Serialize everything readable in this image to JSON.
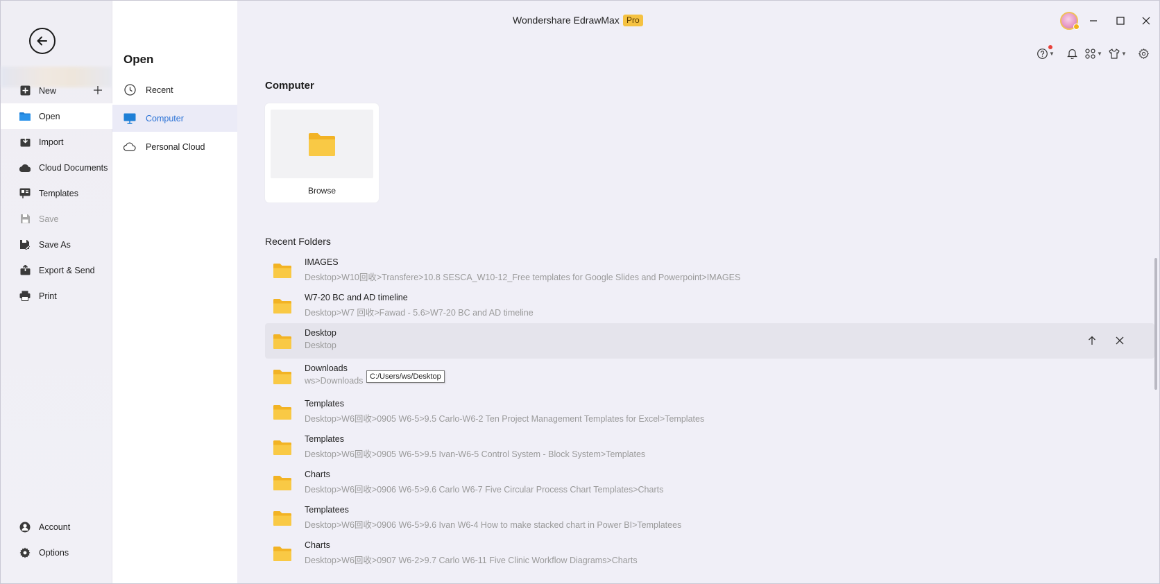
{
  "window": {
    "title": "Wondershare EdrawMax",
    "badge": "Pro"
  },
  "sidebar": {
    "items": [
      {
        "label": "New",
        "icon": "plus-square-icon"
      },
      {
        "label": "Open",
        "icon": "folder-icon"
      },
      {
        "label": "Import",
        "icon": "import-icon"
      },
      {
        "label": "Cloud Documents",
        "icon": "cloud-icon"
      },
      {
        "label": "Templates",
        "icon": "templates-icon"
      },
      {
        "label": "Save",
        "icon": "save-icon"
      },
      {
        "label": "Save As",
        "icon": "save-as-icon"
      },
      {
        "label": "Export & Send",
        "icon": "export-icon"
      },
      {
        "label": "Print",
        "icon": "print-icon"
      }
    ],
    "bottom": [
      {
        "label": "Account",
        "icon": "account-icon"
      },
      {
        "label": "Options",
        "icon": "gear-icon"
      }
    ]
  },
  "open_panel": {
    "title": "Open",
    "items": [
      {
        "label": "Recent",
        "icon": "clock-icon"
      },
      {
        "label": "Computer",
        "icon": "monitor-icon"
      },
      {
        "label": "Personal Cloud",
        "icon": "cloud-outline-icon"
      }
    ]
  },
  "main": {
    "section_title": "Computer",
    "browse_label": "Browse",
    "recent_title": "Recent Folders",
    "tooltip": "C:/Users/ws/Desktop",
    "folders": [
      {
        "name": "IMAGES",
        "path": "Desktop>W10回收>Transfere>10.8 SESCA_W10-12_Free templates for Google Slides and Powerpoint>IMAGES"
      },
      {
        "name": "W7-20 BC and AD timeline",
        "path": "Desktop>W7 回收>Fawad - 5.6>W7-20 BC and AD timeline"
      },
      {
        "name": "Desktop",
        "path": "Desktop"
      },
      {
        "name": "Downloads",
        "path": "ws>Downloads"
      },
      {
        "name": "Templates",
        "path": "Desktop>W6回收>0905 W6-5>9.5 Carlo-W6-2 Ten Project Management Templates for Excel>Templates"
      },
      {
        "name": "Templates",
        "path": "Desktop>W6回收>0905 W6-5>9.5 Ivan-W6-5 Control System - Block System>Templates"
      },
      {
        "name": "Charts",
        "path": "Desktop>W6回收>0906 W6-5>9.6 Carlo W6-7 Five Circular Process Chart Templates>Charts"
      },
      {
        "name": "Templatees",
        "path": "Desktop>W6回收>0906 W6-5>9.6 Ivan W6-4 How to make stacked chart in Power BI>Templatees"
      },
      {
        "name": "Charts",
        "path": "Desktop>W6回收>0907 W6-2>9.7 Carlo W6-11 Five Clinic Workflow Diagrams>Charts"
      }
    ]
  },
  "colors": {
    "accent": "#2a72d6",
    "folder": "#f7c23a",
    "badge": "#f5c242"
  }
}
